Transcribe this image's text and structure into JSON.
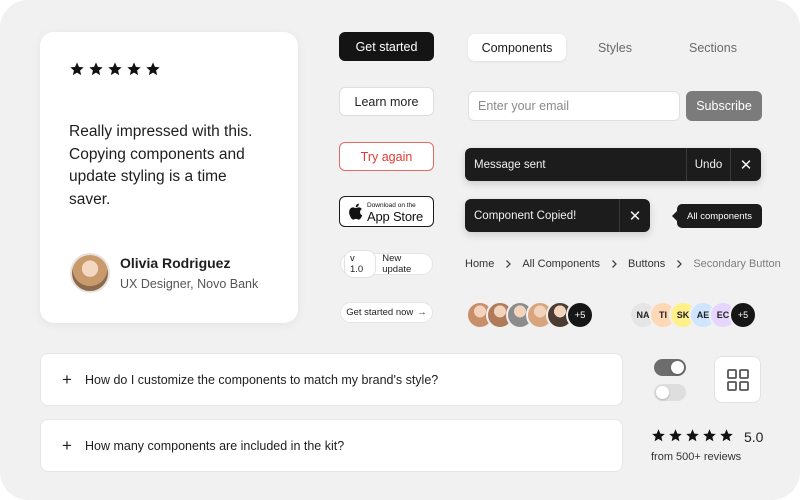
{
  "testimonial": {
    "stars": 5,
    "quote": "Really impressed with this. Copying components and update styling is a time saver.",
    "name": "Olivia Rodriguez",
    "role": "UX Designer, Novo Bank"
  },
  "buttons": {
    "primary": "Get started",
    "secondary": "Learn more",
    "danger": "Try again"
  },
  "app_store": {
    "small_text": "Download on the",
    "big_text": "App Store"
  },
  "version_badge": {
    "version": "v 1.0",
    "label": "New update"
  },
  "small_cta": {
    "label": "Get started now",
    "arrow": "→"
  },
  "tabs": [
    "Components",
    "Styles",
    "Sections"
  ],
  "active_tab": "Components",
  "subscribe": {
    "placeholder": "Enter your email",
    "value": "",
    "button": "Subscribe"
  },
  "toasts": {
    "message_sent": "Message sent",
    "undo": "Undo",
    "component_copied": "Component Copied!",
    "close_glyph": "✕"
  },
  "tooltip": "All components",
  "breadcrumb": [
    "Home",
    "All Components",
    "Buttons",
    "Secondary Button"
  ],
  "avatar_group": {
    "photo_count": 5,
    "more": "+5",
    "photo_colors": [
      "#c98e6b",
      "#b07b5a",
      "#8c8c8c",
      "#d9a57f",
      "#4b3b33"
    ]
  },
  "initials_group": {
    "items": [
      {
        "text": "NA",
        "color": "#e5e5e5"
      },
      {
        "text": "TI",
        "color": "#ffd8b5"
      },
      {
        "text": "SK",
        "color": "#fff08a"
      },
      {
        "text": "AE",
        "color": "#cfe4ff"
      },
      {
        "text": "EC",
        "color": "#e6d6ff"
      }
    ],
    "more": "+5"
  },
  "faq": [
    "How do I customize the components to match my brand's style?",
    "How many components are included in the kit?"
  ],
  "faq_icon": "+",
  "toggles": {
    "first": true,
    "second": false
  },
  "rating": {
    "stars": 5,
    "score": "5.0",
    "count_label": "from 500+ reviews"
  },
  "colors": {
    "background": "#f1f1f1",
    "dark": "#141414",
    "danger": "#e03b34",
    "subscribe": "#7b7b7b"
  }
}
